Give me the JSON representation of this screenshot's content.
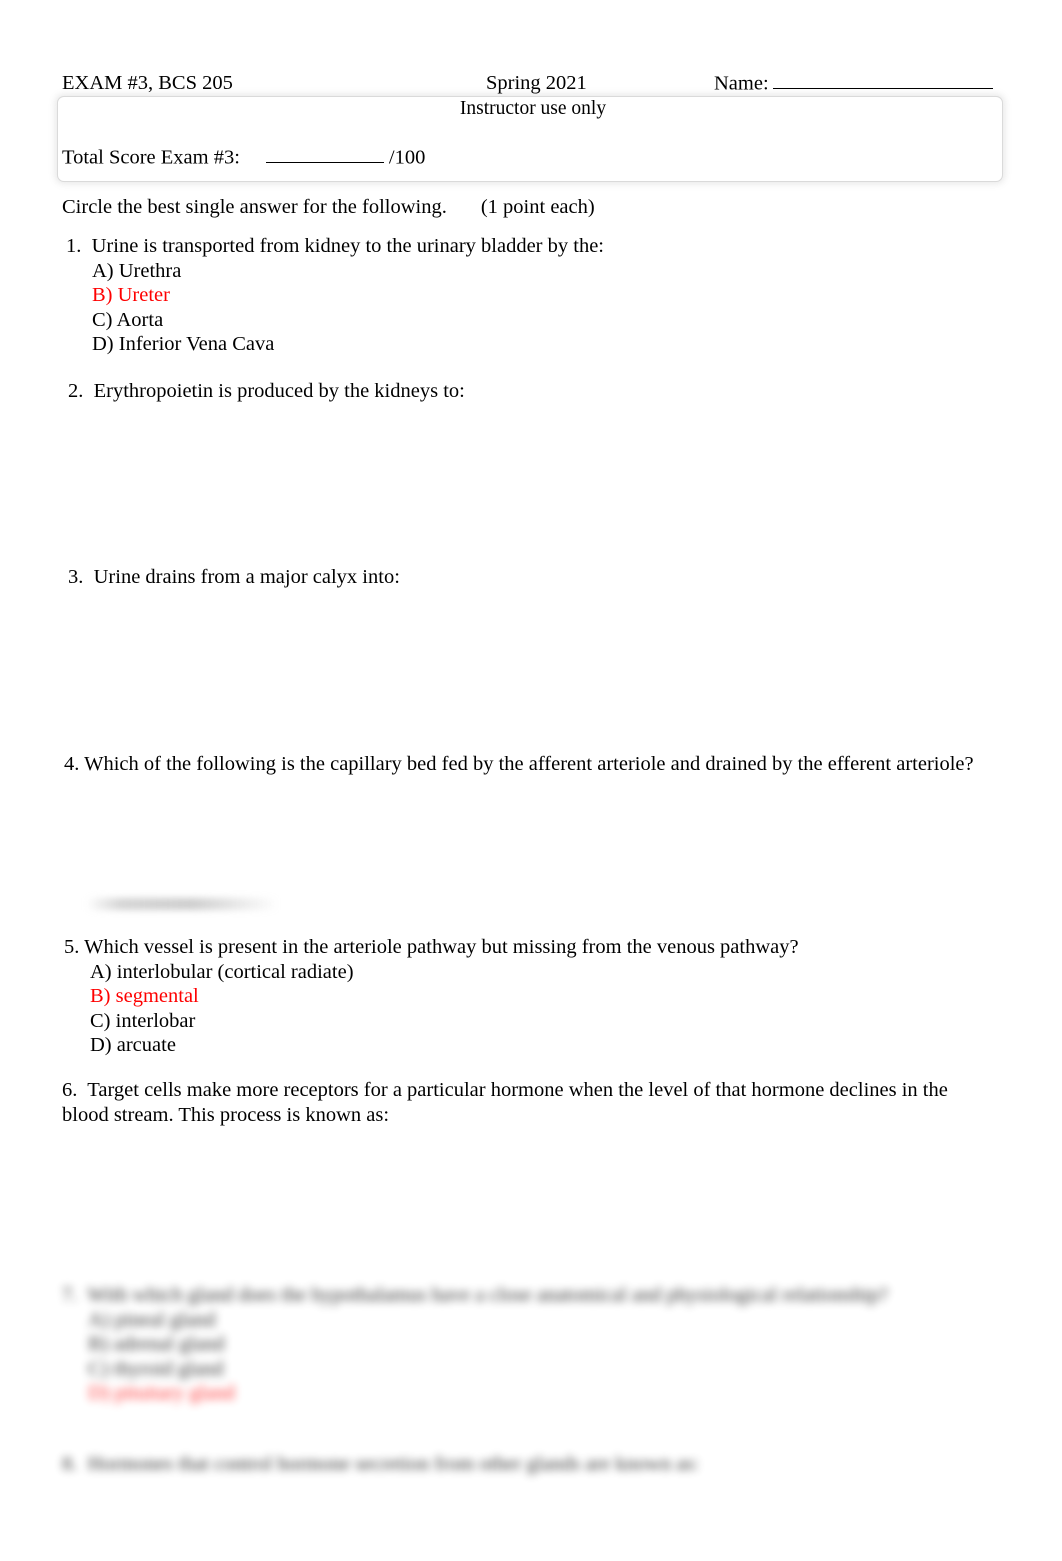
{
  "document": {
    "type": "exam-answer-key",
    "accent_correct_color": "#fe0000",
    "text_color": "#000000",
    "background_color": "#ffffff"
  },
  "header": {
    "exam_title": "EXAM #3, BCS 205",
    "term": "Spring 2021",
    "name_label": "Name:",
    "instructor_box_label": "Instructor use only",
    "total_score_label": "Total Score Exam #3:",
    "total_score_out_of": "/100"
  },
  "instructions": {
    "text": "Circle the best single answer for the following.",
    "points": "(1 point each)"
  },
  "questions": [
    {
      "number": "1.",
      "stem": "Urine is transported from kidney to the urinary bladder by the:",
      "options": [
        {
          "label": "A) Urethra",
          "correct": false
        },
        {
          "label": "B) Ureter",
          "correct": true
        },
        {
          "label": "C) Aorta",
          "correct": false
        },
        {
          "label": "D) Inferior Vena Cava",
          "correct": false
        }
      ]
    },
    {
      "number": "2.",
      "stem": "Erythropoietin is produced by the kidneys to:",
      "options": []
    },
    {
      "number": "3.",
      "stem": "Urine drains from a major calyx into:",
      "options": []
    },
    {
      "number": "4.",
      "stem": "Which of the following is the capillary bed fed by the afferent arteriole and drained by the efferent arteriole?",
      "options": []
    },
    {
      "number": "5.",
      "stem": "Which vessel is present in the arteriole pathway but missing from the venous pathway?",
      "options": [
        {
          "label": "A) interlobular (cortical radiate)",
          "correct": false
        },
        {
          "label": "B) segmental",
          "correct": true
        },
        {
          "label": "C) interlobar",
          "correct": false
        },
        {
          "label": "D) arcuate",
          "correct": false
        }
      ]
    },
    {
      "number": "6.",
      "stem": "Target cells make more receptors for a particular hormone when the level of that hormone declines in the blood stream.  This process is known as:",
      "options": []
    },
    {
      "number": "7.",
      "stem": "With which gland does the hypothalamus have a close anatomical and physiological relationship?",
      "blurred": true,
      "options": [
        {
          "label": "A) pineal gland",
          "correct": false
        },
        {
          "label": "B) adrenal gland",
          "correct": false
        },
        {
          "label": "C) thyroid gland",
          "correct": false
        },
        {
          "label": "D) pituitary gland",
          "correct": true
        }
      ]
    },
    {
      "number": "8.",
      "stem": "Hormones that control hormone secretion from other glands are known as:",
      "blurred": true,
      "options": []
    }
  ]
}
